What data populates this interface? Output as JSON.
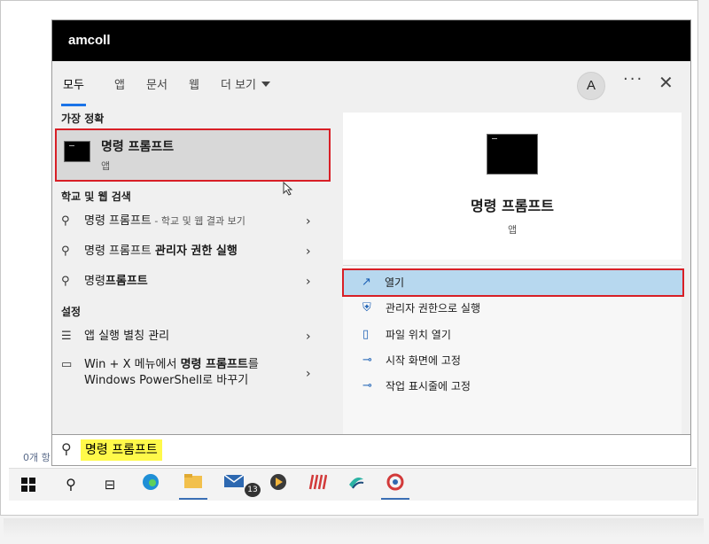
{
  "window": {
    "title": "amcoll"
  },
  "tabs": [
    {
      "label": "모두",
      "active": true
    },
    {
      "label": "앱"
    },
    {
      "label": "문서"
    },
    {
      "label": "웹"
    },
    {
      "label": "더 보기"
    }
  ],
  "header": {
    "avatar": "A",
    "more": "···",
    "close": "✕"
  },
  "left": {
    "best_match_heading": "가장 정확",
    "best_match": {
      "title": "명령 프롬프트",
      "subtitle": "앱"
    },
    "web_heading": "학교 및 웹 검색",
    "web_results": [
      {
        "text": "명령 프롬프트",
        "suffix": " - 학교 및 웹 결과 보기"
      },
      {
        "text": "명령 프롬프트 ",
        "bold": "관리자 권한 실행"
      },
      {
        "text": "명령",
        "bold": "프롬프트"
      }
    ],
    "settings_heading": "설정",
    "settings_results": [
      {
        "text": "앱 실행 별칭 관리"
      },
      {
        "line1_prefix": "Win + X 메뉴에서 ",
        "line1_bold": "명령 프롬프트",
        "line1_suffix": "를",
        "line2": "Windows PowerShell로 바꾸기"
      }
    ],
    "chevron": "›"
  },
  "right": {
    "title": "명령 프롬프트",
    "subtitle": "앱",
    "actions": [
      {
        "label": "열기",
        "icon": "open-icon"
      },
      {
        "label": "관리자 권한으로 실행",
        "icon": "shield-icon"
      },
      {
        "label": "파일 위치 열기",
        "icon": "file-location-icon"
      },
      {
        "label": "시작 화면에 고정",
        "icon": "pin-icon"
      },
      {
        "label": "작업 표시줄에 고정",
        "icon": "pin-icon"
      }
    ]
  },
  "search": {
    "value": "명령 프롬프트"
  },
  "background": {
    "status_text": "0개 항"
  },
  "taskbar": {
    "mail_badge": "13"
  },
  "colors": {
    "highlight_border": "#d81f26",
    "selected_bg": "#b7d8ef",
    "search_highlight": "#fff94a"
  }
}
